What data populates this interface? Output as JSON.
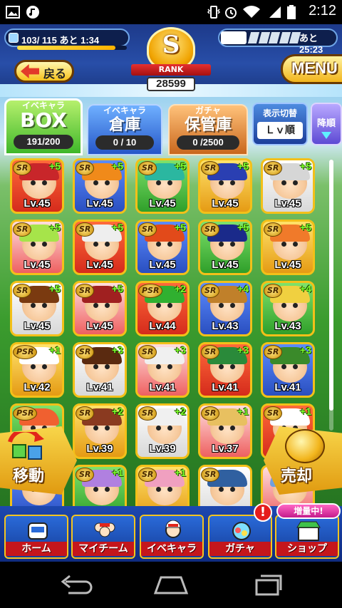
{
  "status_bar": {
    "time": "2:12",
    "icons": [
      "image-icon",
      "music-icon",
      "vibrate-icon",
      "alarm-icon",
      "wifi-icon",
      "signal-icon",
      "battery-icon"
    ]
  },
  "header": {
    "stamina": "103/ 115 あと  1:34",
    "stamina_fraction": 0.896,
    "rank": {
      "letter": "S",
      "label": "RANK",
      "score": "28599"
    },
    "ticket_timer": "あと25:23",
    "back_label": "戻る",
    "menu_label": "MENU"
  },
  "tabs": [
    {
      "line1": "イベキャラ",
      "line2": "BOX",
      "count": "191/200",
      "active": true
    },
    {
      "line1": "イベキャラ",
      "line2": "倉庫",
      "count": "0  /  10",
      "active": false
    },
    {
      "line1": "ガチャ",
      "line2": "保管庫",
      "count": "0  /2500",
      "active": false
    }
  ],
  "sort": {
    "title": "表示切替",
    "value": "Ｌｖ順",
    "order": "降順"
  },
  "cards": [
    {
      "rarity": "SR",
      "plus": "+5",
      "level": "Lv.45"
    },
    {
      "rarity": "SR",
      "plus": "+5",
      "level": "Lv.45"
    },
    {
      "rarity": "SR",
      "plus": "+5",
      "level": "Lv.45"
    },
    {
      "rarity": "SR",
      "plus": "+5",
      "level": "Lv.45"
    },
    {
      "rarity": "SR",
      "plus": "+5",
      "level": "Lv.45"
    },
    {
      "rarity": "SR",
      "plus": "+5",
      "level": "Lv.45"
    },
    {
      "rarity": "SR",
      "plus": "+5",
      "level": "Lv.45"
    },
    {
      "rarity": "SR",
      "plus": "+5",
      "level": "Lv.45"
    },
    {
      "rarity": "SR",
      "plus": "+5",
      "level": "Lv.45"
    },
    {
      "rarity": "SR",
      "plus": "+5",
      "level": "Lv.45"
    },
    {
      "rarity": "SR",
      "plus": "+5",
      "level": "Lv.45"
    },
    {
      "rarity": "SR",
      "plus": "+5",
      "level": "Lv.45"
    },
    {
      "rarity": "PSR",
      "plus": "+2",
      "level": "Lv.44"
    },
    {
      "rarity": "SR",
      "plus": "+4",
      "level": "Lv.43"
    },
    {
      "rarity": "SR",
      "plus": "+4",
      "level": "Lv.43"
    },
    {
      "rarity": "PSR",
      "plus": "+1",
      "level": "Lv.42"
    },
    {
      "rarity": "SR",
      "plus": "+3",
      "level": "Lv.41"
    },
    {
      "rarity": "SR",
      "plus": "+3",
      "level": "Lv.41"
    },
    {
      "rarity": "SR",
      "plus": "+3",
      "level": "Lv.41"
    },
    {
      "rarity": "SR",
      "plus": "+3",
      "level": "Lv.41"
    },
    {
      "rarity": "PSR",
      "plus": "",
      "level": ""
    },
    {
      "rarity": "SR",
      "plus": "+2",
      "level": "Lv.39"
    },
    {
      "rarity": "SR",
      "plus": "+2",
      "level": "Lv.39"
    },
    {
      "rarity": "SR",
      "plus": "+1",
      "level": "Lv.37"
    },
    {
      "rarity": "SR",
      "plus": "+1",
      "level": ""
    },
    {
      "rarity": "",
      "plus": "",
      "level": ""
    },
    {
      "rarity": "SR",
      "plus": "+1",
      "level": ""
    },
    {
      "rarity": "SR",
      "plus": "+1",
      "level": ""
    },
    {
      "rarity": "SR",
      "plus": "",
      "level": ""
    },
    {
      "rarity": "",
      "plus": "",
      "level": ""
    }
  ],
  "actions": {
    "move_label": "移動",
    "sell_label": "売却"
  },
  "bottom_nav": [
    {
      "label": "ホーム",
      "icon": "home-icon"
    },
    {
      "label": "マイチーム",
      "icon": "team-icon"
    },
    {
      "label": "イベキャラ",
      "icon": "event-character-icon"
    },
    {
      "label": "ガチャ",
      "icon": "gacha-icon"
    },
    {
      "label": "ショップ",
      "icon": "shop-icon"
    }
  ],
  "notice_badge": "!",
  "shop_badge": "増量中!",
  "system_nav": [
    "back-icon",
    "home-icon",
    "recents-icon"
  ],
  "colors": {
    "card_border": "#f3c019",
    "level_plus": "#7dff2c",
    "nav_label_bg": "#c4161c"
  }
}
